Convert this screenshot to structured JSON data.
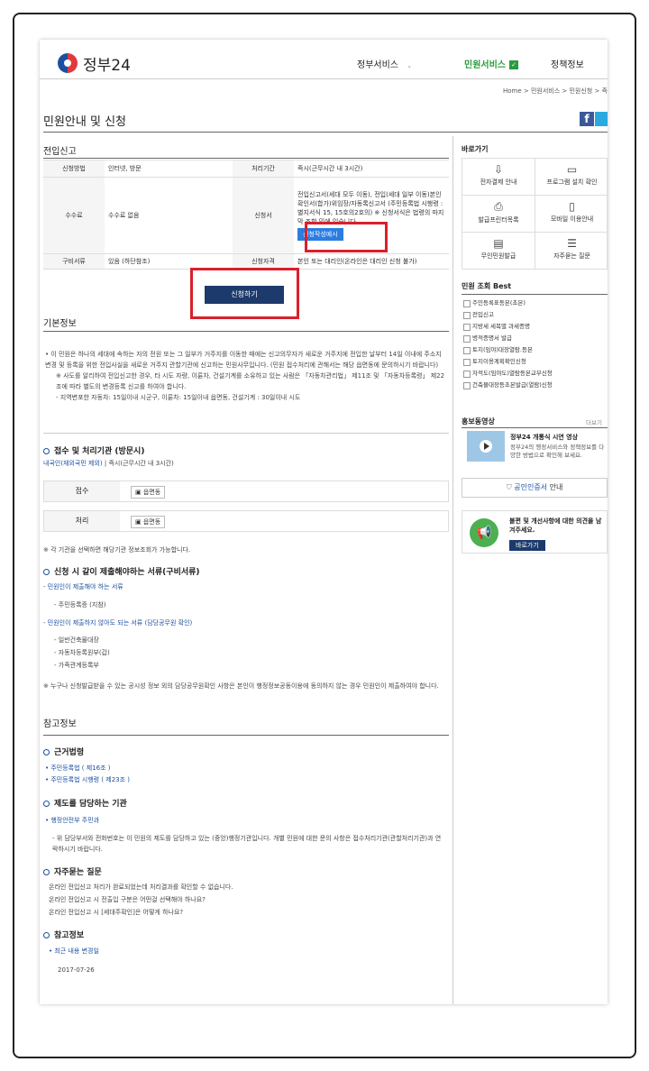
{
  "header": {
    "logo": "정부24",
    "nav": [
      "정부서비스",
      "민원서비스",
      "정책정보"
    ],
    "active_check": "✓",
    "breadcrumb": "Home > 민원서비스 > 민원신청 > 즉"
  },
  "page_title": "민원안내 및 신청",
  "section_title": "전입신고",
  "info_table": {
    "labels": {
      "method": "신청방법",
      "period": "처리기간",
      "fee": "수수료",
      "form": "신청서",
      "docs": "구비서류",
      "qualification": "신청자격"
    },
    "values": {
      "method": "인터넷, 방문",
      "period": "즉시(근무시간 내 3시간)",
      "fee": "수수료 없음",
      "form": "전입신고서(세대 모두 이동), 전입(세대 일부 이동)본인확인서(합가)위임장/자동록신고서 (주민등록법 시행령 : 별지서식 15, 15호의2호의) ※ 신청서식은 법령의 마지막 조항 밑에 있습니다.",
      "form_button": "신청작성예시",
      "docs": "있음 (하단참조)",
      "qualification": "본인 또는 대리인(온라인은 대리인 신청 불가)"
    }
  },
  "apply_button": "신청하기",
  "basic_info": {
    "title": "기본정보",
    "p1": "• 이 민원은 하나의 세대에 속하는 자의 전원 또는 그 일부가 거주지를 이동한 때에는 신고의무자가 새로운 거주지에 전입한 날부터 14일 이내에 주소지변경 및 등록을 위한 전입사실을 새로운 거주지 관할기관에 신고하는 민원사무입니다. (민원 접수처리에 관해서는 해당 읍면동에 문의하시기 바랍니다)",
    "p2": "※ 사도를 알리하여 전입신고한 경우, 타 시도 자량, 이륜차, 건설기계를 소유하고 있는 사람은 「자동차관리법」 제11조 및 「자동차등록령」 제22조에 따라 별도의 변경등록 신고를 하여야 합니다.",
    "p3": "- 지역변포한 자동차: 15일이내 시군구, 이륜차: 15일이내 읍면동, 건설기계 : 30일이내 시도"
  },
  "reception": {
    "title": "접수 및 처리기관 (방문시)",
    "sub_blue": "내국인(재외국민 제외)",
    "sub_rest": " | 즉시(근무시간 내 3시간)",
    "rows": [
      {
        "label": "접수",
        "value": "읍면동"
      },
      {
        "label": "처리",
        "value": "읍면동"
      }
    ],
    "note": "※ 각 기관을 선택하면 해당기관 정보조회가 가능합니다."
  },
  "documents": {
    "title": "신청 시 같이 제출해야하는 서류(구비서류)",
    "required_label": "- 민원인이 제출해야 하는 서류",
    "required_items": [
      "- 주민등록증 (지참)"
    ],
    "optional_label": "- 민원인이 제출하지 않아도 되는 서류 (담당공무원 확인)",
    "optional_items": [
      "- 일반건축물대장",
      "- 자동차등록원부(갑)",
      "- 가족관계등록부"
    ],
    "note": "※ 누구나 신청발급받을 수 있는 공시성 정보 외의 담당공무원확인 사항은 본인이 행정정보공동이용에 동의하지 않는 경우 민원인이 제출하여야 합니다."
  },
  "reference": {
    "title": "참고정보",
    "law_title": "근거법령",
    "laws": [
      "• 주민등록법 ( 제16조 )",
      "• 주민등록법 시행령 ( 제23조 )"
    ],
    "org_title": "제도를 담당하는 기관",
    "org": "• 행정안전부  주민과",
    "org_desc": "- 위 담당부서와 전화번호는 이 민원의 제도를 담당하고 있는 (중앙)행정기관입니다. 개별 민원에 대한 문의 사항은 접수처리기관(관할처리기관)과 연락하시기 바랍니다.",
    "faq_title": "자주묻는 질문",
    "faqs": [
      "온라인 전입신고 처리가 완료되었는데 처리결과를 확인할 수 없습니다.",
      "온라인 전입신고 시 전출입 구분은 어떤걸 선택해야 하나요?",
      "온라인 전입신고 시 [세대주확인]은 어떻게 하나요?"
    ],
    "ref_title": "참고정보",
    "ref_item": "• 최근 내용 변경일",
    "ref_date": "2017-07-26"
  },
  "sidebar": {
    "quick_title": "바로가기",
    "quick": [
      {
        "label": "전자결제 안내",
        "icon": "⇩"
      },
      {
        "label": "프로그램 설치 확인",
        "icon": "▭"
      },
      {
        "label": "발급프린터목록",
        "icon": "⎙"
      },
      {
        "label": "모바일 이용안내",
        "icon": "▯"
      },
      {
        "label": "무인민원발급",
        "icon": "▤"
      },
      {
        "label": "자주묻는 질문",
        "icon": "☰"
      }
    ],
    "best_title": "민원 조회 Best",
    "best": [
      "주민등록표등본(초본)",
      "전입신고",
      "지방세 세목별 과세증명",
      "병적증명서 발급",
      "토지(임야)대장열람.등본",
      "토지이용계획확인신청",
      "자적도(임야도)열람등본교부신청",
      "건축물대장등초본발급(열람)신청"
    ],
    "promo_title": "홍보동영상",
    "promo_more": "더보기",
    "promo_heading": "정부24 개통식 시연 영상",
    "promo_desc": "정부24의 행정서비스와 정책정보를 다양한 방법으로 확인해 보세요.",
    "cert_label": "공인인증서",
    "cert_suffix": " 안내",
    "feedback_text": "불편 및 개선사항에 대한 의견을 남겨주세요.",
    "feedback_button": "바로가기"
  },
  "colors": {
    "brand_blue": "#1b4fa0",
    "active_green": "#2a9c3e",
    "highlight_red": "#d9202b",
    "button_navy": "#1c3a6b"
  }
}
